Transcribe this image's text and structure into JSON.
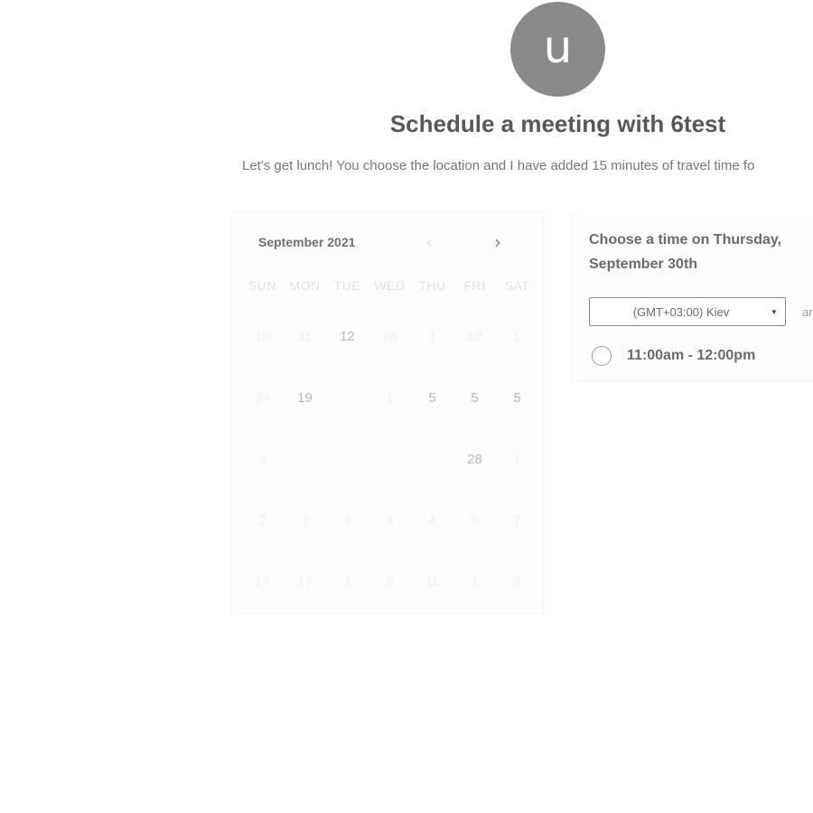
{
  "avatar": {
    "initial": "u"
  },
  "title": "Schedule a meeting with 6test",
  "subtitle": "Let's get lunch! You choose the location and I have added 15 minutes of travel time fo",
  "calendar": {
    "month_label": "September 2021",
    "weekdays": [
      "SUN",
      "MON",
      "TUE",
      "WED",
      "THU",
      "FRI",
      "SAT"
    ],
    "weeks": [
      [
        {
          "d": "10",
          "a": false
        },
        {
          "d": "11",
          "a": false
        },
        {
          "d": "12",
          "a": true
        },
        {
          "d": "26",
          "a": false
        },
        {
          "d": "1",
          "a": false
        },
        {
          "d": "12",
          "a": false
        },
        {
          "d": "1",
          "a": false
        }
      ],
      [
        {
          "d": "24",
          "a": false
        },
        {
          "d": "19",
          "a": true
        },
        {
          "d": "",
          "a": false
        },
        {
          "d": "1",
          "a": false
        },
        {
          "d": "5",
          "a": true
        },
        {
          "d": "5",
          "a": true
        },
        {
          "d": "5",
          "a": true
        }
      ],
      [
        {
          "d": "2",
          "a": false
        },
        {
          "d": "",
          "a": false
        },
        {
          "d": "",
          "a": false
        },
        {
          "d": "",
          "a": false
        },
        {
          "d": "",
          "a": false
        },
        {
          "d": "28",
          "a": true
        },
        {
          "d": "1",
          "a": false
        }
      ],
      [
        {
          "d": "2",
          "a": false
        },
        {
          "d": "3",
          "a": false
        },
        {
          "d": "4",
          "a": false
        },
        {
          "d": "4",
          "a": false
        },
        {
          "d": "4",
          "a": false
        },
        {
          "d": "5",
          "a": false
        },
        {
          "d": "7",
          "a": false
        }
      ],
      [
        {
          "d": "17",
          "a": false
        },
        {
          "d": "17",
          "a": false
        },
        {
          "d": "1",
          "a": false
        },
        {
          "d": "9",
          "a": false
        },
        {
          "d": "11",
          "a": false
        },
        {
          "d": "1",
          "a": false
        },
        {
          "d": "3",
          "a": false
        }
      ]
    ]
  },
  "time_panel": {
    "heading": "Choose a time on Thursday, September 30th",
    "timezone": "(GMT+03:00) Kiev",
    "timezone_side": "an",
    "slots": [
      "11:00am - 12:00pm"
    ]
  },
  "colors": {
    "avatar_bg": "#8a8a8a",
    "text_dark": "#585858",
    "text_muted": "#777777"
  }
}
